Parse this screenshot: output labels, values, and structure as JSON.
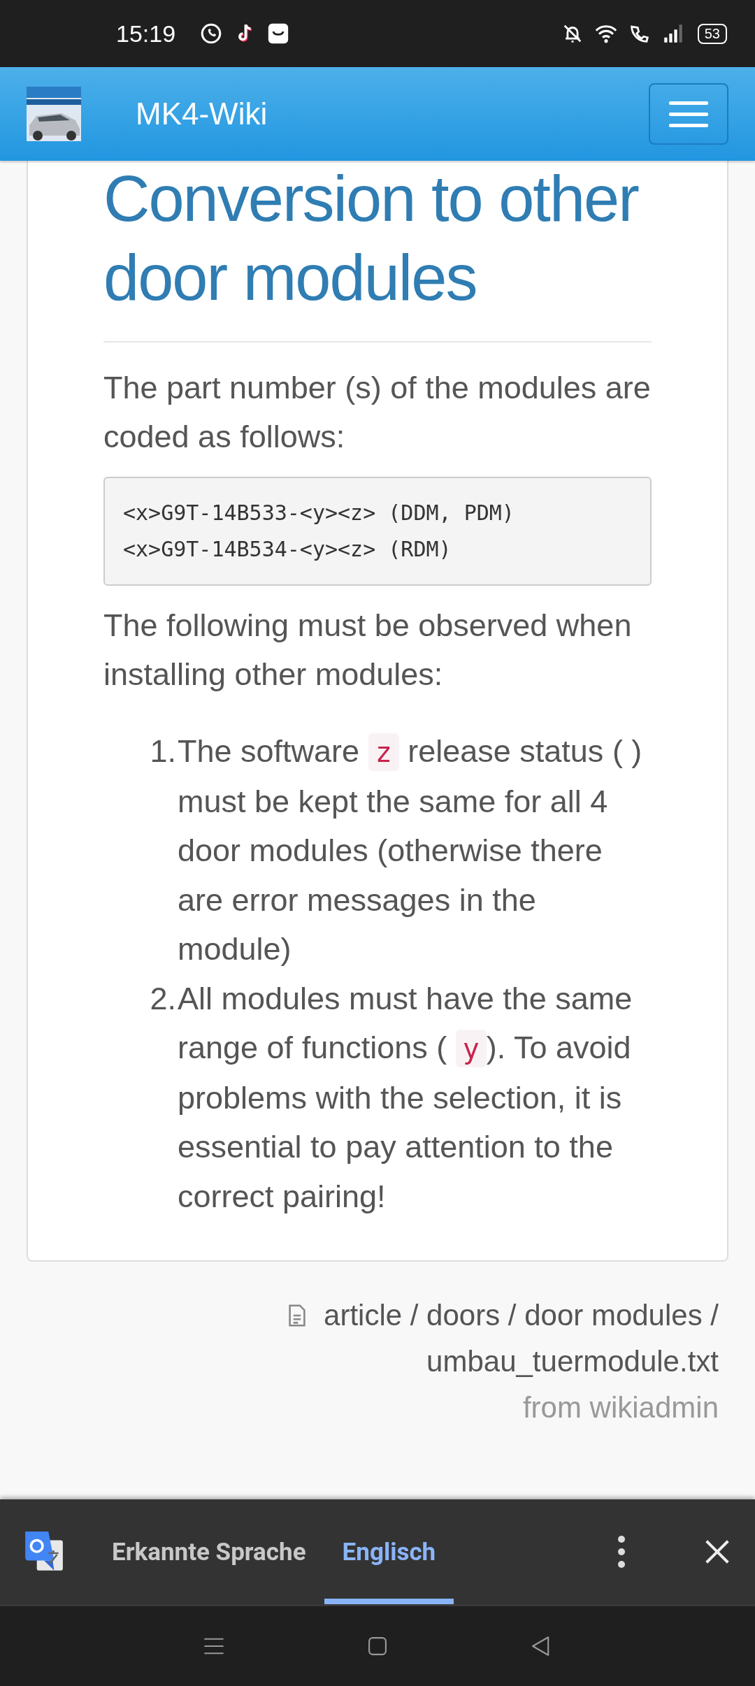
{
  "status_bar": {
    "time": "15:19",
    "battery": "53"
  },
  "header": {
    "title": "MK4-Wiki"
  },
  "article": {
    "heading": "Conversion to other door modules",
    "intro": "The part number (s) of the modules are coded as follows:",
    "code_lines": [
      "<x>G9T-14B533-<y><z> (DDM, PDM)",
      "<x>G9T-14B534-<y><z> (RDM)"
    ],
    "lead": "The following must be observed when installing other modules:",
    "items": [
      {
        "number": "1.",
        "before": "The software ",
        "code": "z",
        "after": " release status ( ) must be kept the same for all 4 door modules (otherwise there are error messages in the module)"
      },
      {
        "number": "2.",
        "before": "All modules must have the same range of functions ( ",
        "code": "y",
        "after": "). To avoid problems with the selection, it is essential to pay attention to the correct pairing!"
      }
    ]
  },
  "footer": {
    "path": "article / doors / door modules / umbau_tuermodule.txt",
    "author": "from wikiadmin"
  },
  "translate_bar": {
    "tabs": [
      {
        "label": "Erkannte Sprache",
        "selected": false
      },
      {
        "label": "Englisch",
        "selected": true
      }
    ]
  }
}
